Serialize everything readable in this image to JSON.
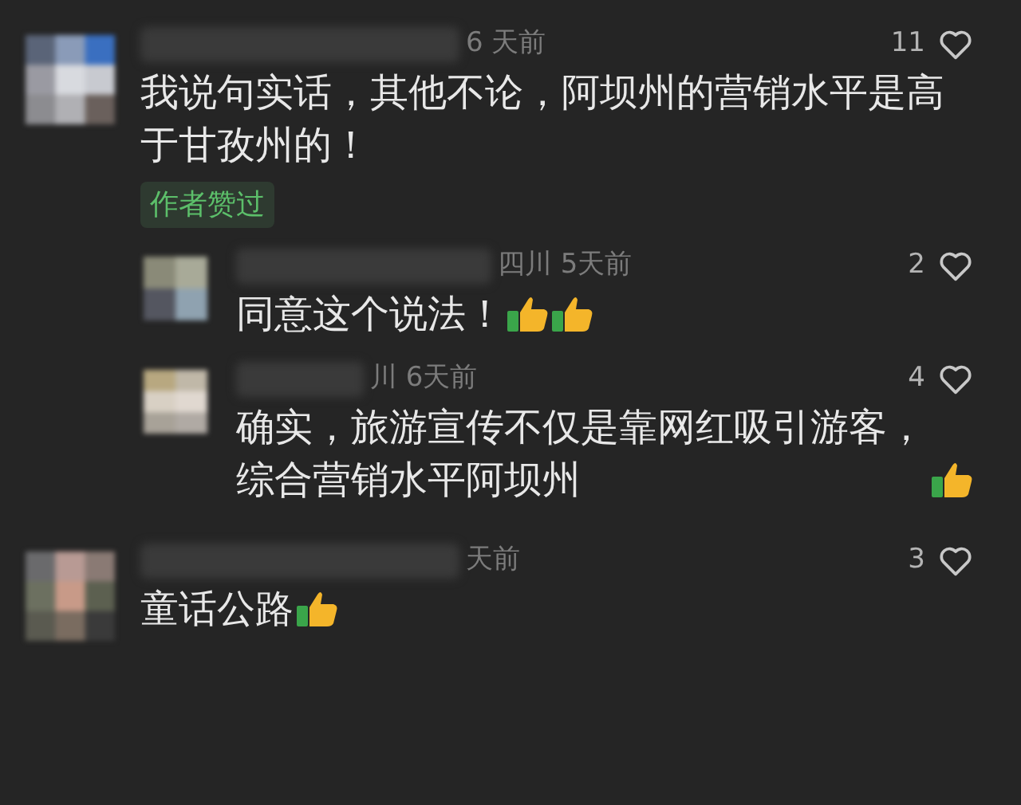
{
  "comments": [
    {
      "time": "6 天前",
      "likes": "11",
      "text": "我说句实话，其他不论，阿坝州的营销水平是高于甘孜州的！",
      "badge": "作者赞过",
      "replies": [
        {
          "time": "四川 5天前",
          "likes": "2",
          "text": "同意这个说法！",
          "reactions": [
            {
              "kind": "thumbs_up"
            },
            {
              "kind": "thumbs_up"
            }
          ]
        },
        {
          "time": "川 6天前",
          "likes": "4",
          "text": "确实，旅游宣传不仅是靠网红吸引游客，综合营销水平阿坝州",
          "reactions": [
            {
              "kind": "thumbs_up"
            }
          ]
        }
      ]
    },
    {
      "time": "天前",
      "likes": "3",
      "text": "童话公路",
      "reactions": [
        {
          "kind": "thumbs_up"
        }
      ]
    }
  ]
}
